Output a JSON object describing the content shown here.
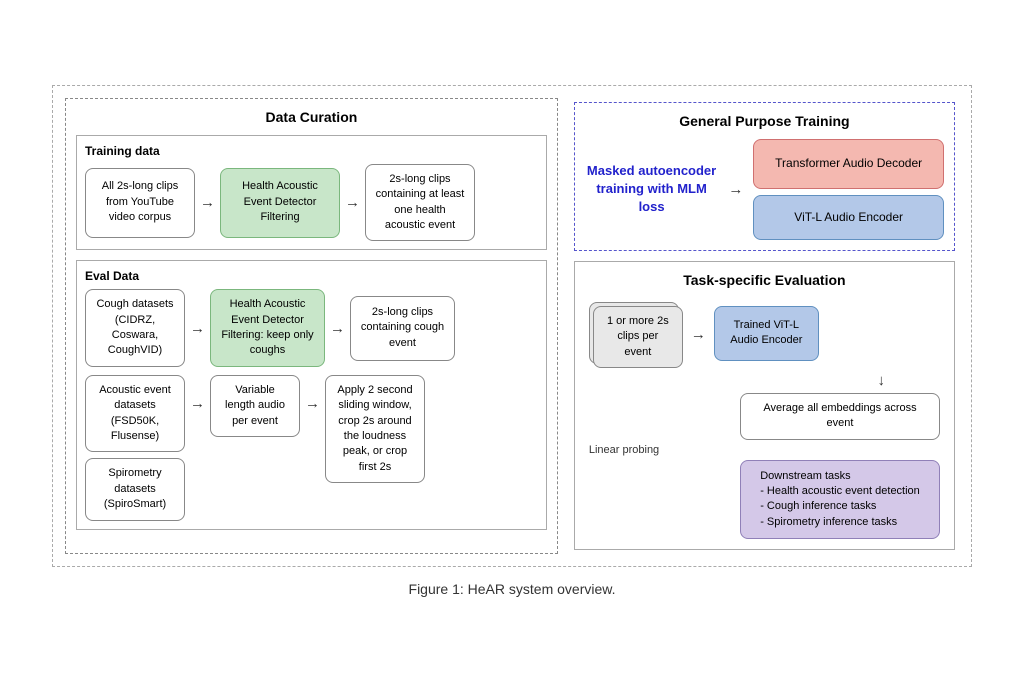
{
  "diagram": {
    "caption": "Figure 1:  HeAR system overview.",
    "dataCuration": {
      "title": "Data Curation",
      "trainingData": {
        "label": "Training data",
        "box1": "All 2s-long clips from YouTube video corpus",
        "box2": "Health Acoustic Event Detector Filtering",
        "box3": "2s-long clips containing at least one health acoustic event"
      },
      "evalData": {
        "label": "Eval Data",
        "row1": {
          "source": "Cough datasets (CIDRZ, Coswara, CoughVID)",
          "filter": "Health Acoustic Event Detector Filtering: keep only coughs",
          "output": "2s-long clips containing cough event"
        },
        "row2": {
          "source": "Acoustic event datasets (FSD50K, Flusense)",
          "filter": "Variable length audio per event",
          "output": "Apply 2 second sliding window, crop 2s around the loudness peak, or crop first 2s"
        },
        "row3": {
          "source": "Spirometry datasets (SpiroSmart)"
        }
      }
    },
    "generalTraining": {
      "title": "General Purpose Training",
      "maskedLabel": "Masked autoencoder training with MLM loss",
      "decoderBox": "Transformer Audio Decoder",
      "encoderBox": "ViT-L Audio Encoder"
    },
    "taskEval": {
      "title": "Task-specific Evaluation",
      "clipsBox": "1 or more 2s clips per event",
      "encoderBox": "Trained ViT-L Audio Encoder",
      "averageBox": "Average all embeddings across event",
      "linearProbing": "Linear probing",
      "downstreamBox": "Downstream tasks\n- Health acoustic event detection\n- Cough inference tasks\n- Spirometry inference tasks"
    }
  }
}
